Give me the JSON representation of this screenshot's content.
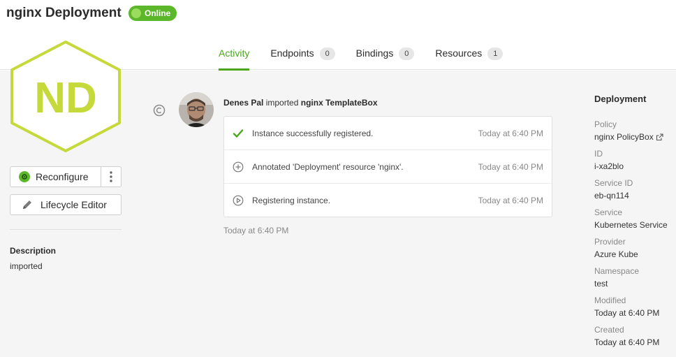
{
  "header": {
    "title": "nginx Deployment",
    "status": "Online",
    "status_color": "#5cb82a"
  },
  "tabs": [
    {
      "label": "Activity",
      "active": true
    },
    {
      "label": "Endpoints",
      "count": "0"
    },
    {
      "label": "Bindings",
      "count": "0"
    },
    {
      "label": "Resources",
      "count": "1"
    }
  ],
  "logo": {
    "initials": "ND",
    "color": "#c6d93a"
  },
  "sidebar": {
    "reconfigure_label": "Reconfigure",
    "lifecycle_label": "Lifecycle Editor",
    "description_label": "Description",
    "description_value": "imported"
  },
  "activity": {
    "user": "Denes Pal",
    "verb": "imported",
    "target": "nginx TemplateBox",
    "entries": [
      {
        "icon": "check-icon",
        "text": "Instance successfully registered.",
        "time": "Today at 6:40 PM"
      },
      {
        "icon": "plus-circle-icon",
        "text": "Annotated 'Deployment' resource 'nginx'.",
        "time": "Today at 6:40 PM"
      },
      {
        "icon": "play-circle-icon",
        "text": "Registering instance.",
        "time": "Today at 6:40 PM"
      }
    ],
    "footer_time": "Today at 6:40 PM"
  },
  "details": {
    "title": "Deployment",
    "fields": [
      {
        "label": "Policy",
        "value": "nginx PolicyBox"
      },
      {
        "label": "ID",
        "value": "i-xa2blo"
      },
      {
        "label": "Service ID",
        "value": "eb-qn114"
      },
      {
        "label": "Service",
        "value": "Kubernetes Service"
      },
      {
        "label": "Provider",
        "value": "Azure Kube"
      },
      {
        "label": "Namespace",
        "value": "test"
      },
      {
        "label": "Modified",
        "value": "Today at 6:40 PM"
      },
      {
        "label": "Created",
        "value": "Today at 6:40 PM"
      }
    ]
  }
}
